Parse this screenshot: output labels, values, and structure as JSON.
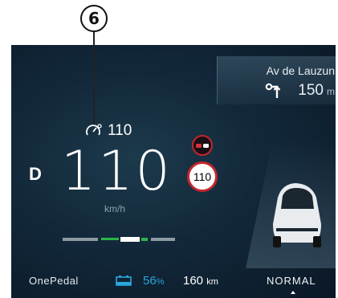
{
  "callout": {
    "number": "6"
  },
  "navigation": {
    "street": "Av de Lauzun",
    "distance": "150",
    "distance_unit": "m",
    "turn_icon": "turn-right-icon"
  },
  "cruise": {
    "icon": "speedometer-icon",
    "set_speed": "110"
  },
  "drive": {
    "gear": "D",
    "speed": "110",
    "speed_unit": "km/h"
  },
  "speed_limit": {
    "value": "110",
    "radar_icon": "speed-camera-icon",
    "color": "#c2272d"
  },
  "lane_assist": {
    "icon": "lane-position-icon"
  },
  "status": {
    "regen_mode": "OnePedal",
    "battery_icon": "battery-icon",
    "battery_percent": "56",
    "battery_percent_symbol": "%",
    "range": "160",
    "range_unit": "km",
    "drive_mode": "NORMAL",
    "accent_color": "#2aa7dc"
  }
}
